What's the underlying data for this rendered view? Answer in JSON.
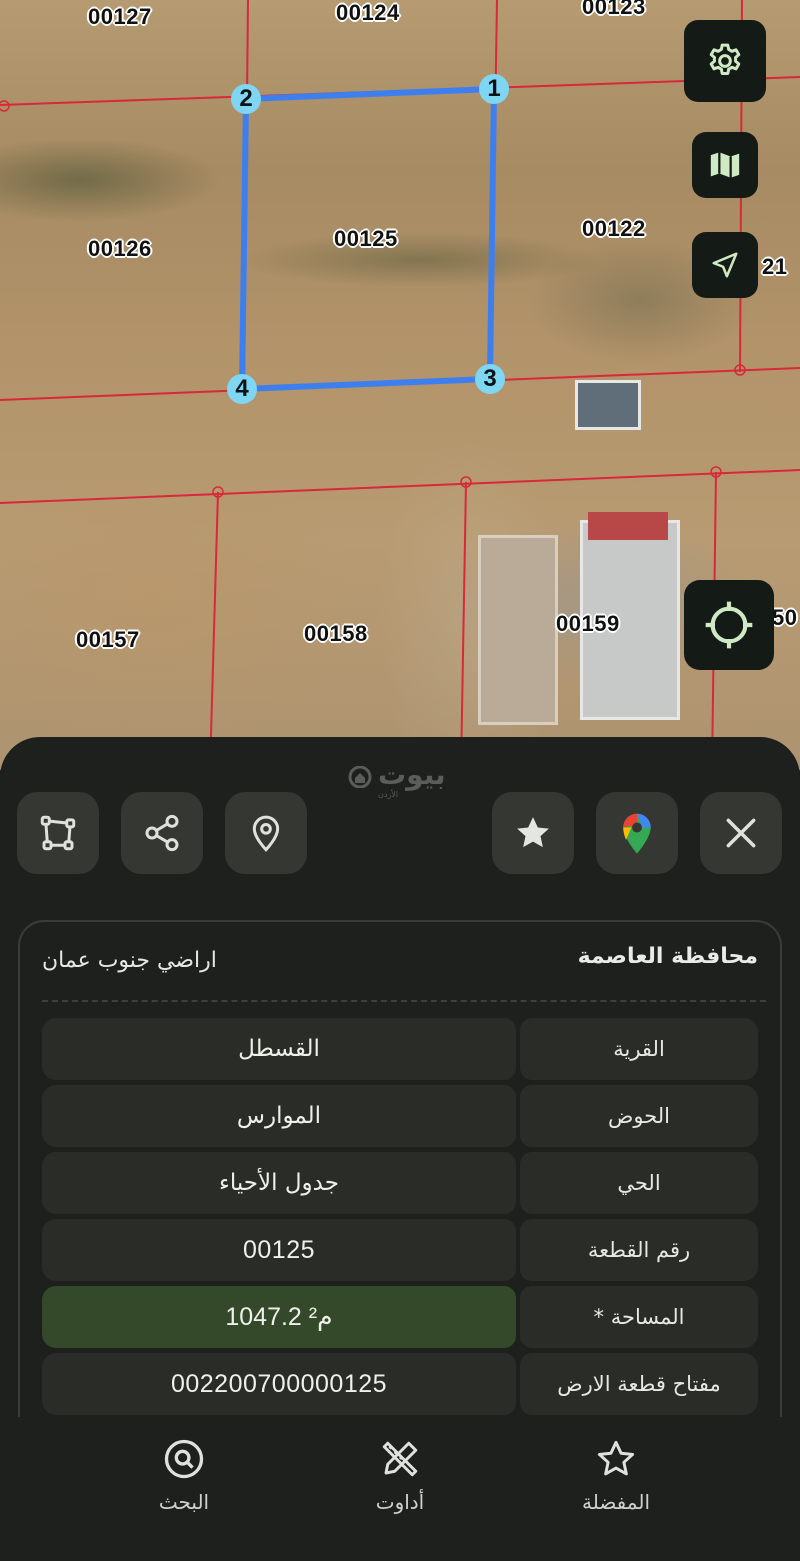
{
  "map": {
    "parcels": [
      {
        "id": "00127"
      },
      {
        "id": "00124"
      },
      {
        "id": "00123"
      },
      {
        "id": "00126"
      },
      {
        "id": "00125"
      },
      {
        "id": "00122"
      },
      {
        "id": "21"
      },
      {
        "id": "00157"
      },
      {
        "id": "00158"
      },
      {
        "id": "00159"
      },
      {
        "id": "50"
      }
    ],
    "vertices": [
      "1",
      "2",
      "3",
      "4"
    ],
    "boundary_color": "#3e7ff0",
    "grid_color": "#d8283a",
    "controls": {
      "settings_icon": "gear-icon",
      "layers_icon": "map-icon",
      "navigate_icon": "navigation-arrow-icon",
      "locate_icon": "crosshair-icon"
    }
  },
  "brand": {
    "name": "بيوت",
    "sub": "الأردن"
  },
  "actions": {
    "draw": "polygon-icon",
    "share": "share-icon",
    "location": "map-pin-icon",
    "favorite": "star-icon",
    "google_maps": "google-maps-icon",
    "close": "close-icon"
  },
  "details": {
    "governorate": "محافظة العاصمة",
    "lands": "اراضي جنوب عمان",
    "rows": [
      {
        "label": "القرية",
        "value": "القسطل"
      },
      {
        "label": "الحوض",
        "value": "الموارس"
      },
      {
        "label": "الحي",
        "value": "جدول الأحياء"
      },
      {
        "label": "رقم القطعة",
        "value": "00125"
      },
      {
        "label": "المساحة *",
        "value": "1047.2 م²"
      },
      {
        "label": "مفتاح قطعة الارض",
        "value": "002200700000125"
      }
    ]
  },
  "nav": {
    "search": "البحث",
    "tools": "أداوت",
    "favorites": "المفضلة"
  },
  "colors": {
    "accent_highlight": "#34482a",
    "panel": "#1d201c",
    "cell": "#2a2d27"
  }
}
